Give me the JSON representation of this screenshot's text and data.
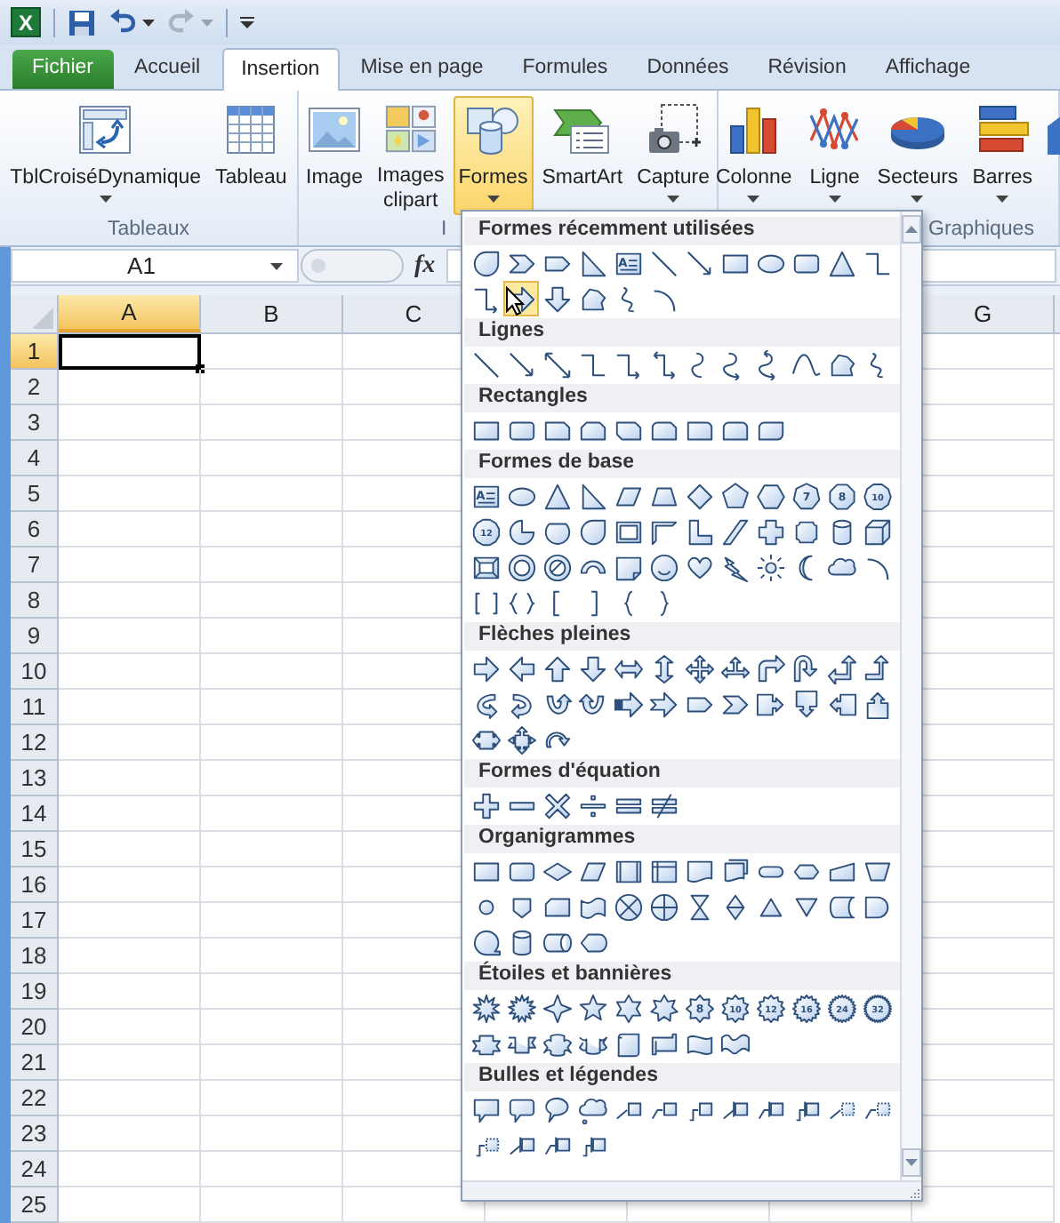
{
  "title_bar": {
    "logo_letter": "X",
    "quick_access": [
      {
        "kind": "save",
        "disabled": false
      },
      {
        "kind": "undo",
        "disabled": false
      },
      {
        "kind": "redo",
        "disabled": true
      }
    ]
  },
  "tabs": [
    {
      "label": "Fichier",
      "kind": "file",
      "selected": false
    },
    {
      "label": "Accueil",
      "kind": "tab",
      "selected": false
    },
    {
      "label": "Insertion",
      "kind": "tab",
      "selected": true
    },
    {
      "label": "Mise en page",
      "kind": "tab",
      "selected": false
    },
    {
      "label": "Formules",
      "kind": "tab",
      "selected": false
    },
    {
      "label": "Données",
      "kind": "tab",
      "selected": false
    },
    {
      "label": "Révision",
      "kind": "tab",
      "selected": false
    },
    {
      "label": "Affichage",
      "kind": "tab",
      "selected": false
    }
  ],
  "ribbon": {
    "groups": [
      {
        "label": "Tableaux",
        "buttons": [
          {
            "label": "TblCroiséDynamique",
            "kind": "pivot",
            "dropdown": true,
            "pressed": false
          },
          {
            "label": "Tableau",
            "kind": "table",
            "dropdown": false,
            "pressed": false
          }
        ]
      },
      {
        "label": "I",
        "buttons": [
          {
            "label": "Image",
            "kind": "image",
            "dropdown": false,
            "pressed": false
          },
          {
            "label": "Images\nclipart",
            "kind": "clipart",
            "dropdown": false,
            "pressed": false
          },
          {
            "label": "Formes",
            "kind": "shapes",
            "dropdown": true,
            "pressed": true
          },
          {
            "label": "SmartArt",
            "kind": "smartart",
            "dropdown": false,
            "pressed": false
          },
          {
            "label": "Capture",
            "kind": "screenshot",
            "dropdown": true,
            "pressed": false
          }
        ]
      },
      {
        "label": "Graphiques",
        "buttons": [
          {
            "label": "Colonne",
            "kind": "column",
            "dropdown": true,
            "pressed": false
          },
          {
            "label": "Ligne",
            "kind": "line",
            "dropdown": true,
            "pressed": false
          },
          {
            "label": "Secteurs",
            "kind": "pie",
            "dropdown": true,
            "pressed": false
          },
          {
            "label": "Barres",
            "kind": "bar",
            "dropdown": true,
            "pressed": false
          },
          {
            "kind": "area",
            "dropdown": false,
            "pressed": false
          }
        ]
      }
    ]
  },
  "formula_bar": {
    "name_box": "A1",
    "function_label": "fx"
  },
  "sheet": {
    "columns": [
      {
        "label": "A",
        "selected": true
      },
      {
        "label": "B",
        "selected": false
      },
      {
        "label": "C",
        "selected": false
      },
      {
        "label": "G",
        "selected": false
      }
    ],
    "rows": [
      {
        "label": "1",
        "selected": true
      },
      {
        "label": "2",
        "selected": false
      },
      {
        "label": "3",
        "selected": false
      },
      {
        "label": "4",
        "selected": false
      },
      {
        "label": "5",
        "selected": false
      },
      {
        "label": "6",
        "selected": false
      },
      {
        "label": "7",
        "selected": false
      },
      {
        "label": "8",
        "selected": false
      },
      {
        "label": "9",
        "selected": false
      },
      {
        "label": "10",
        "selected": false
      },
      {
        "label": "11",
        "selected": false
      },
      {
        "label": "12",
        "selected": false
      },
      {
        "label": "13",
        "selected": false
      },
      {
        "label": "14",
        "selected": false
      },
      {
        "label": "15",
        "selected": false
      },
      {
        "label": "16",
        "selected": false
      },
      {
        "label": "17",
        "selected": false
      },
      {
        "label": "18",
        "selected": false
      },
      {
        "label": "19",
        "selected": false
      },
      {
        "label": "20",
        "selected": false
      },
      {
        "label": "21",
        "selected": false
      },
      {
        "label": "22",
        "selected": false
      },
      {
        "label": "23",
        "selected": false
      },
      {
        "label": "24",
        "selected": false
      },
      {
        "label": "25",
        "selected": false
      }
    ]
  },
  "shapes_menu": {
    "sections": [
      {
        "title": "Formes récemment utilisées",
        "shapes": [
          {
            "kind": "teardrop",
            "selected": false
          },
          {
            "kind": "chevron",
            "selected": false
          },
          {
            "kind": "home-plate",
            "selected": false
          },
          {
            "kind": "right-triangle",
            "selected": false
          },
          {
            "kind": "text-box",
            "label": "A",
            "selected": false
          },
          {
            "kind": "line",
            "selected": false
          },
          {
            "kind": "line-arrow",
            "selected": false
          },
          {
            "kind": "rectangle",
            "selected": false
          },
          {
            "kind": "oval",
            "selected": false
          },
          {
            "kind": "rounded-rectangle",
            "selected": false
          },
          {
            "kind": "triangle",
            "selected": false
          },
          {
            "kind": "elbow-connector",
            "selected": false
          },
          {
            "kind": "elbow-arrow-connector",
            "selected": false
          },
          {
            "kind": "right-arrow",
            "selected": true
          },
          {
            "kind": "down-arrow",
            "selected": false
          },
          {
            "kind": "freeform",
            "selected": false
          },
          {
            "kind": "scribble",
            "selected": false
          },
          {
            "kind": "arc",
            "selected": false
          }
        ]
      },
      {
        "title": "Lignes",
        "shapes": [
          {
            "kind": "line",
            "selected": false
          },
          {
            "kind": "line-arrow",
            "selected": false
          },
          {
            "kind": "double-arrow-line",
            "selected": false
          },
          {
            "kind": "elbow-connector",
            "selected": false
          },
          {
            "kind": "elbow-arrow-connector",
            "selected": false
          },
          {
            "kind": "elbow-double-arrow-connector",
            "selected": false
          },
          {
            "kind": "curved-connector",
            "selected": false
          },
          {
            "kind": "curved-arrow-connector",
            "selected": false
          },
          {
            "kind": "curved-double-arrow-connector",
            "selected": false
          },
          {
            "kind": "curve",
            "selected": false
          },
          {
            "kind": "freeform",
            "selected": false
          },
          {
            "kind": "scribble",
            "selected": false
          }
        ]
      },
      {
        "title": "Rectangles",
        "shapes": [
          {
            "kind": "rectangle",
            "selected": false
          },
          {
            "kind": "rounded-rectangle",
            "selected": false
          },
          {
            "kind": "snip-corner-rectangle",
            "selected": false
          },
          {
            "kind": "snip-two-corners-rectangle",
            "selected": false
          },
          {
            "kind": "snip-diagonal-rectangle",
            "selected": false
          },
          {
            "kind": "snip-round-rectangle",
            "selected": false
          },
          {
            "kind": "round-corner-rectangle",
            "selected": false
          },
          {
            "kind": "round-two-corners-rectangle",
            "selected": false
          },
          {
            "kind": "round-diagonal-rectangle",
            "selected": false
          }
        ]
      },
      {
        "title": "Formes de base",
        "shapes": [
          {
            "kind": "text-box",
            "label": "A",
            "selected": false
          },
          {
            "kind": "oval",
            "selected": false
          },
          {
            "kind": "triangle",
            "selected": false
          },
          {
            "kind": "right-triangle",
            "selected": false
          },
          {
            "kind": "parallelogram",
            "selected": false
          },
          {
            "kind": "trapezoid",
            "selected": false
          },
          {
            "kind": "diamond",
            "selected": false
          },
          {
            "kind": "pentagon",
            "selected": false
          },
          {
            "kind": "hexagon",
            "selected": false
          },
          {
            "kind": "heptagon",
            "label": "7",
            "selected": false
          },
          {
            "kind": "octagon",
            "label": "8",
            "selected": false
          },
          {
            "kind": "decagon",
            "label": "10",
            "selected": false
          },
          {
            "kind": "dodecagon",
            "label": "12",
            "selected": false
          },
          {
            "kind": "pie",
            "selected": false
          },
          {
            "kind": "chord",
            "selected": false
          },
          {
            "kind": "teardrop",
            "selected": false
          },
          {
            "kind": "frame",
            "selected": false
          },
          {
            "kind": "half-frame",
            "selected": false
          },
          {
            "kind": "l-shape",
            "selected": false
          },
          {
            "kind": "diagonal-stripe",
            "selected": false
          },
          {
            "kind": "cross",
            "selected": false
          },
          {
            "kind": "plaque",
            "selected": false
          },
          {
            "kind": "can",
            "selected": false
          },
          {
            "kind": "cube",
            "selected": false
          },
          {
            "kind": "bevel",
            "selected": false
          },
          {
            "kind": "donut",
            "selected": false
          },
          {
            "kind": "no-symbol",
            "selected": false
          },
          {
            "kind": "block-arc",
            "selected": false
          },
          {
            "kind": "folded-corner",
            "selected": false
          },
          {
            "kind": "smiley",
            "selected": false
          },
          {
            "kind": "heart",
            "selected": false
          },
          {
            "kind": "lightning",
            "selected": false
          },
          {
            "kind": "sun",
            "selected": false
          },
          {
            "kind": "moon",
            "selected": false
          },
          {
            "kind": "cloud",
            "selected": false
          },
          {
            "kind": "arc",
            "selected": false
          },
          {
            "kind": "bracket-pair",
            "selected": false
          },
          {
            "kind": "brace-pair",
            "selected": false
          },
          {
            "kind": "left-bracket",
            "selected": false
          },
          {
            "kind": "right-bracket",
            "selected": false
          },
          {
            "kind": "left-brace",
            "selected": false
          },
          {
            "kind": "right-brace",
            "selected": false
          }
        ]
      },
      {
        "title": "Flèches pleines",
        "shapes": [
          {
            "kind": "right-arrow",
            "selected": false
          },
          {
            "kind": "left-arrow",
            "selected": false
          },
          {
            "kind": "up-arrow",
            "selected": false
          },
          {
            "kind": "down-arrow",
            "selected": false
          },
          {
            "kind": "left-right-arrow",
            "selected": false
          },
          {
            "kind": "up-down-arrow",
            "selected": false
          },
          {
            "kind": "quad-arrow",
            "selected": false
          },
          {
            "kind": "left-right-up-arrow",
            "selected": false
          },
          {
            "kind": "bent-arrow",
            "selected": false
          },
          {
            "kind": "u-turn-arrow",
            "selected": false
          },
          {
            "kind": "left-up-arrow",
            "selected": false
          },
          {
            "kind": "bent-up-arrow",
            "selected": false
          },
          {
            "kind": "curved-right-arrow",
            "selected": false
          },
          {
            "kind": "curved-left-arrow",
            "selected": false
          },
          {
            "kind": "curved-up-arrow",
            "selected": false
          },
          {
            "kind": "curved-down-arrow",
            "selected": false
          },
          {
            "kind": "striped-right-arrow",
            "selected": false
          },
          {
            "kind": "notched-right-arrow",
            "selected": false
          },
          {
            "kind": "home-plate",
            "selected": false
          },
          {
            "kind": "chevron",
            "selected": false
          },
          {
            "kind": "right-arrow-callout",
            "selected": false
          },
          {
            "kind": "down-arrow-callout",
            "selected": false
          },
          {
            "kind": "left-arrow-callout",
            "selected": false
          },
          {
            "kind": "up-arrow-callout",
            "selected": false
          },
          {
            "kind": "left-right-arrow-callout",
            "selected": false
          },
          {
            "kind": "quad-arrow-callout",
            "selected": false
          },
          {
            "kind": "circular-arrow",
            "selected": false
          }
        ]
      },
      {
        "title": "Formes d'équation",
        "shapes": [
          {
            "kind": "plus",
            "selected": false
          },
          {
            "kind": "minus",
            "selected": false
          },
          {
            "kind": "multiply",
            "selected": false
          },
          {
            "kind": "divide",
            "selected": false
          },
          {
            "kind": "equal",
            "selected": false
          },
          {
            "kind": "not-equal",
            "selected": false
          }
        ]
      },
      {
        "title": "Organigrammes",
        "shapes": [
          {
            "kind": "rectangle",
            "selected": false
          },
          {
            "kind": "rounded-rectangle",
            "selected": false
          },
          {
            "kind": "decision",
            "selected": false
          },
          {
            "kind": "parallelogram",
            "selected": false
          },
          {
            "kind": "predefined-process",
            "selected": false
          },
          {
            "kind": "internal-storage",
            "selected": false
          },
          {
            "kind": "document",
            "selected": false
          },
          {
            "kind": "multidocument",
            "selected": false
          },
          {
            "kind": "terminator",
            "selected": false
          },
          {
            "kind": "preparation",
            "selected": false
          },
          {
            "kind": "manual-input",
            "selected": false
          },
          {
            "kind": "manual-operation",
            "selected": false
          },
          {
            "kind": "connector",
            "selected": false
          },
          {
            "kind": "off-page-connector",
            "selected": false
          },
          {
            "kind": "card",
            "selected": false
          },
          {
            "kind": "punched-tape",
            "selected": false
          },
          {
            "kind": "summing-junction",
            "selected": false
          },
          {
            "kind": "or-symbol",
            "selected": false
          },
          {
            "kind": "collate",
            "selected": false
          },
          {
            "kind": "sort",
            "selected": false
          },
          {
            "kind": "extract",
            "selected": false
          },
          {
            "kind": "merge",
            "selected": false
          },
          {
            "kind": "stored-data",
            "selected": false
          },
          {
            "kind": "delay",
            "selected": false
          },
          {
            "kind": "sequential-access",
            "selected": false
          },
          {
            "kind": "can",
            "selected": false
          },
          {
            "kind": "direct-access",
            "selected": false
          },
          {
            "kind": "display",
            "selected": false
          }
        ]
      },
      {
        "title": "Étoiles et bannières",
        "shapes": [
          {
            "kind": "explosion",
            "selected": false
          },
          {
            "kind": "explosion-large",
            "selected": false
          },
          {
            "kind": "star-4",
            "selected": false
          },
          {
            "kind": "star-5",
            "selected": false
          },
          {
            "kind": "star-6",
            "selected": false
          },
          {
            "kind": "star-7",
            "selected": false
          },
          {
            "kind": "star-8",
            "label": "8",
            "selected": false
          },
          {
            "kind": "star-10",
            "label": "10",
            "selected": false
          },
          {
            "kind": "star-12",
            "label": "12",
            "selected": false
          },
          {
            "kind": "star-16",
            "label": "16",
            "selected": false
          },
          {
            "kind": "star-24",
            "label": "24",
            "selected": false
          },
          {
            "kind": "star-32",
            "label": "32",
            "selected": false
          },
          {
            "kind": "ribbon-up",
            "selected": false
          },
          {
            "kind": "ribbon-down",
            "selected": false
          },
          {
            "kind": "curved-ribbon-up",
            "selected": false
          },
          {
            "kind": "curved-ribbon-down",
            "selected": false
          },
          {
            "kind": "vertical-scroll",
            "selected": false
          },
          {
            "kind": "horizontal-scroll",
            "selected": false
          },
          {
            "kind": "wave",
            "selected": false
          },
          {
            "kind": "double-wave",
            "selected": false
          }
        ]
      },
      {
        "title": "Bulles et légendes",
        "shapes": [
          {
            "kind": "rectangular-callout",
            "selected": false
          },
          {
            "kind": "rounded-callout",
            "selected": false
          },
          {
            "kind": "oval-callout",
            "selected": false
          },
          {
            "kind": "cloud-callout",
            "selected": false
          },
          {
            "kind": "line-callout",
            "selected": false
          },
          {
            "kind": "bent-line-callout",
            "selected": false
          },
          {
            "kind": "double-bent-line-callout",
            "selected": false
          },
          {
            "kind": "accent-line-callout",
            "selected": false
          },
          {
            "kind": "accent-bent-callout",
            "selected": false
          },
          {
            "kind": "accent-double-callout",
            "selected": false
          },
          {
            "kind": "borderless-callout",
            "selected": false
          },
          {
            "kind": "borderless-bent-callout",
            "selected": false
          },
          {
            "kind": "borderless-double-callout",
            "selected": false
          },
          {
            "kind": "border-accent-callout",
            "selected": false
          },
          {
            "kind": "border-accent-bent-callout",
            "selected": false
          },
          {
            "kind": "border-accent-double-callout",
            "selected": false
          }
        ]
      }
    ]
  }
}
